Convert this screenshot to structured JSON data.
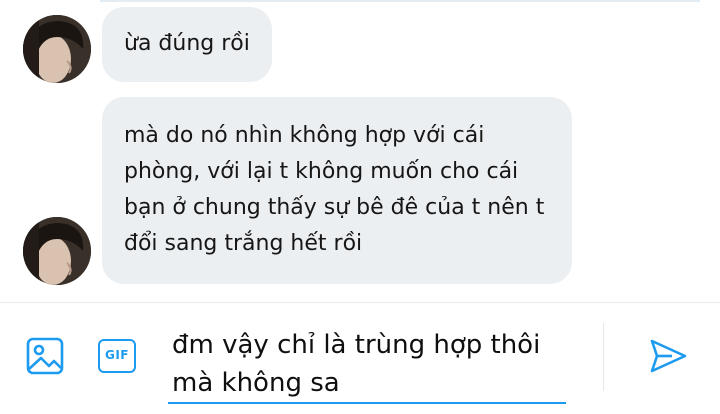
{
  "conversation": {
    "messages": [
      {
        "sender": "other",
        "lines": [
          "ừa đúng rồi"
        ]
      },
      {
        "sender": "other",
        "lines": [
          "mà do nó nhìn không hợp với cái",
          "phòng, với lại t không muốn cho cái",
          "bạn ở chung thấy sự bê đê của t nên t",
          "đổi sang trắng hết rồi"
        ]
      }
    ]
  },
  "composer": {
    "draft_lines": [
      "đm vậy chỉ là trùng hợp thôi",
      "mà không sa"
    ],
    "image_icon": "image-icon",
    "gif_label": "GIF",
    "send_icon": "send-icon"
  },
  "colors": {
    "accent": "#1d9bf0",
    "bubble_bg": "#eceff2",
    "text": "#161616"
  }
}
